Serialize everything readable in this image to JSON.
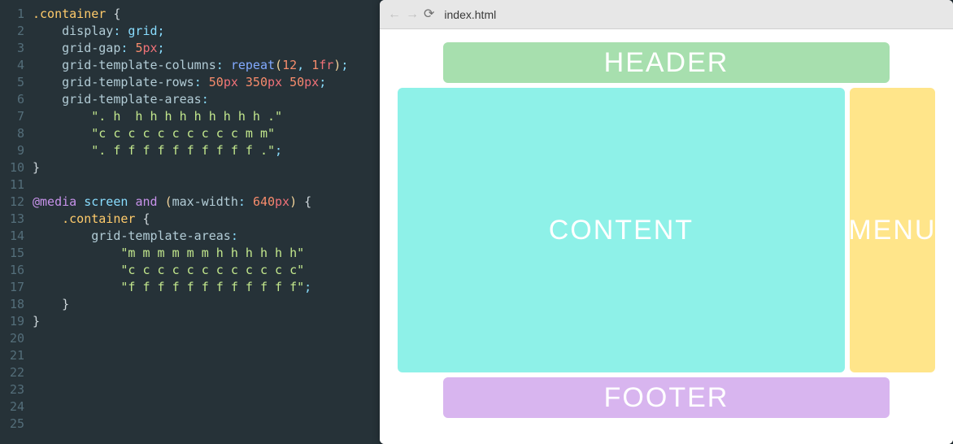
{
  "editor": {
    "language": "css",
    "line_count": 25,
    "lines": [
      {
        "n": 1,
        "tokens": [
          [
            "sel",
            ".container"
          ],
          [
            "",
            ""
          ],
          [
            "brace",
            " {"
          ]
        ]
      },
      {
        "n": 2,
        "tokens": [
          [
            "",
            "    "
          ],
          [
            "prop",
            "display"
          ],
          [
            "punc",
            ": "
          ],
          [
            "val",
            "grid"
          ],
          [
            "punc",
            ";"
          ]
        ]
      },
      {
        "n": 3,
        "tokens": [
          [
            "",
            "    "
          ],
          [
            "prop",
            "grid-gap"
          ],
          [
            "punc",
            ": "
          ],
          [
            "num",
            "5"
          ],
          [
            "unit",
            "px"
          ],
          [
            "punc",
            ";"
          ]
        ]
      },
      {
        "n": 4,
        "tokens": [
          [
            "",
            "    "
          ],
          [
            "prop",
            "grid-template-columns"
          ],
          [
            "punc",
            ": "
          ],
          [
            "fn",
            "repeat"
          ],
          [
            "paren",
            "("
          ],
          [
            "num",
            "12"
          ],
          [
            "punc",
            ", "
          ],
          [
            "num",
            "1"
          ],
          [
            "unit",
            "fr"
          ],
          [
            "paren",
            ")"
          ],
          [
            "punc",
            ";"
          ]
        ]
      },
      {
        "n": 5,
        "tokens": [
          [
            "",
            "    "
          ],
          [
            "prop",
            "grid-template-rows"
          ],
          [
            "punc",
            ": "
          ],
          [
            "num",
            "50"
          ],
          [
            "unit",
            "px"
          ],
          [
            "",
            " "
          ],
          [
            "num",
            "350"
          ],
          [
            "unit",
            "px"
          ],
          [
            "",
            " "
          ],
          [
            "num",
            "50"
          ],
          [
            "unit",
            "px"
          ],
          [
            "punc",
            ";"
          ]
        ]
      },
      {
        "n": 6,
        "tokens": [
          [
            "",
            "    "
          ],
          [
            "prop",
            "grid-template-areas"
          ],
          [
            "punc",
            ":"
          ]
        ]
      },
      {
        "n": 7,
        "tokens": [
          [
            "",
            "        "
          ],
          [
            "str",
            "\". h  h h h h h h h h h .\""
          ]
        ]
      },
      {
        "n": 8,
        "tokens": [
          [
            "",
            "        "
          ],
          [
            "str",
            "\"c c c c c c c c c c m m\""
          ]
        ]
      },
      {
        "n": 9,
        "tokens": [
          [
            "",
            "        "
          ],
          [
            "str",
            "\". f f f f f f f f f f .\""
          ],
          [
            "punc",
            ";"
          ]
        ]
      },
      {
        "n": 10,
        "tokens": [
          [
            "brace",
            "}"
          ]
        ]
      },
      {
        "n": 11,
        "tokens": [
          [
            "",
            ""
          ]
        ]
      },
      {
        "n": 12,
        "tokens": [
          [
            "kw",
            "@media"
          ],
          [
            "",
            " "
          ],
          [
            "val",
            "screen"
          ],
          [
            "",
            " "
          ],
          [
            "kw",
            "and"
          ],
          [
            "",
            " "
          ],
          [
            "paren",
            "("
          ],
          [
            "prop",
            "max-width"
          ],
          [
            "punc",
            ": "
          ],
          [
            "num",
            "640"
          ],
          [
            "unit",
            "px"
          ],
          [
            "paren",
            ")"
          ],
          [
            "",
            " "
          ],
          [
            "brace",
            "{"
          ]
        ]
      },
      {
        "n": 13,
        "tokens": [
          [
            "",
            "    "
          ],
          [
            "sel",
            ".container"
          ],
          [
            "brace",
            " {"
          ]
        ]
      },
      {
        "n": 14,
        "tokens": [
          [
            "",
            "        "
          ],
          [
            "prop",
            "grid-template-areas"
          ],
          [
            "punc",
            ":"
          ]
        ]
      },
      {
        "n": 15,
        "tokens": [
          [
            "",
            "            "
          ],
          [
            "str",
            "\"m m m m m m h h h h h h\""
          ]
        ]
      },
      {
        "n": 16,
        "tokens": [
          [
            "",
            "            "
          ],
          [
            "str",
            "\"c c c c c c c c c c c c\""
          ]
        ]
      },
      {
        "n": 17,
        "tokens": [
          [
            "",
            "            "
          ],
          [
            "str",
            "\"f f f f f f f f f f f f\""
          ],
          [
            "punc",
            ";"
          ]
        ]
      },
      {
        "n": 18,
        "tokens": [
          [
            "",
            "    "
          ],
          [
            "brace",
            "}"
          ]
        ]
      },
      {
        "n": 19,
        "tokens": [
          [
            "brace",
            "}"
          ]
        ]
      },
      {
        "n": 20,
        "tokens": [
          [
            "",
            ""
          ]
        ]
      },
      {
        "n": 21,
        "tokens": [
          [
            "",
            ""
          ]
        ]
      },
      {
        "n": 22,
        "tokens": [
          [
            "",
            ""
          ]
        ]
      },
      {
        "n": 23,
        "tokens": [
          [
            "",
            ""
          ]
        ]
      },
      {
        "n": 24,
        "tokens": [
          [
            "",
            ""
          ]
        ]
      },
      {
        "n": 25,
        "tokens": [
          [
            "",
            ""
          ]
        ]
      }
    ]
  },
  "browser": {
    "toolbar": {
      "back_icon": "←",
      "forward_icon": "→",
      "reload_icon": "⟳",
      "address": "index.html"
    },
    "layout": {
      "header_label": "HEADER",
      "content_label": "CONTENT",
      "menu_label": "MENU",
      "footer_label": "FOOTER"
    },
    "colors": {
      "header": "#a7dfae",
      "content": "#8ef1e8",
      "menu": "#ffe58a",
      "footer": "#d8b5ef"
    }
  }
}
